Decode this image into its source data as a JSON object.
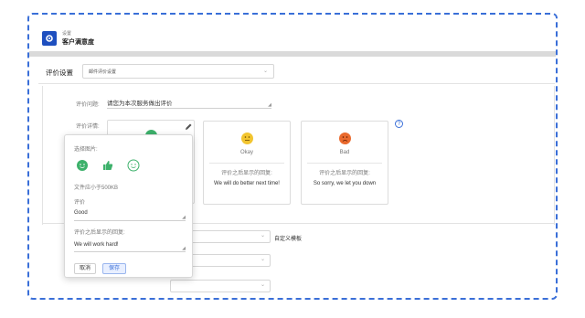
{
  "header": {
    "breadcrumb": "设置",
    "title": "客户满意度"
  },
  "section": {
    "title": "评价设置",
    "select_value": "邮件评价设置"
  },
  "form": {
    "question_label": "评价问题:",
    "question_value": "请您为本次服务做出评价",
    "detail_label": "评价详情:"
  },
  "cards": [
    {
      "face_label": "Okay",
      "response_label": "评价之后显示的回复:",
      "response_text": "We will do better next time!",
      "face_color": "#f2b400"
    },
    {
      "face_label": "Bad",
      "response_label": "评价之后显示的回复:",
      "response_text": "So sorry, we let you down",
      "face_color": "#e85c1a"
    }
  ],
  "popover": {
    "choose_image_label": "选择图片:",
    "file_size_hint": "文件应小于500KB",
    "rating_label": "评价",
    "rating_value": "Good",
    "reply_label": "评价之后显示的回复:",
    "reply_value": "We will work hard!",
    "cancel_label": "取消",
    "save_label": "保存"
  },
  "lower": {
    "custom_template_link": "自定义模板"
  },
  "colors": {
    "accent": "#3a6fd8",
    "brand": "#1e4fbf",
    "good_green": "#3db16b"
  }
}
